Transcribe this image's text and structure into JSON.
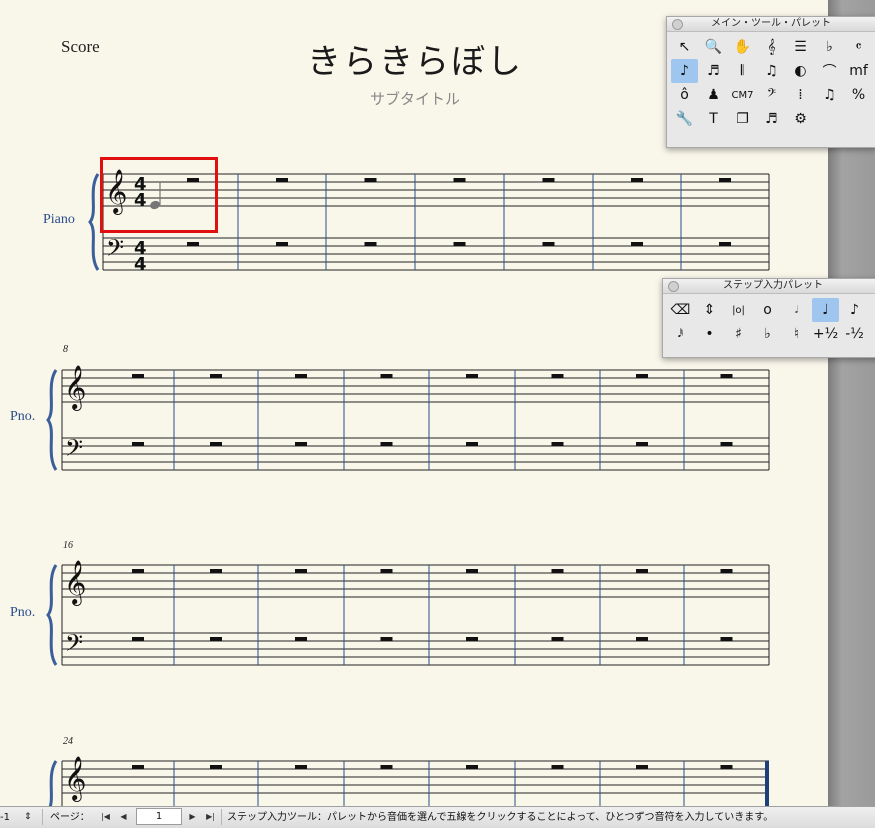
{
  "score": {
    "label": "Score",
    "title": "きらきらぼし",
    "subtitle": "サブタイトル"
  },
  "systems": [
    {
      "instrument": "Piano",
      "measure_number": ""
    },
    {
      "instrument": "Pno.",
      "measure_number": "8"
    },
    {
      "instrument": "Pno.",
      "measure_number": "16"
    },
    {
      "instrument": "",
      "measure_number": "24"
    }
  ],
  "time_signature": {
    "top": "4",
    "bottom": "4"
  },
  "main_palette": {
    "title": "メイン・ツール・パレット",
    "tools": [
      {
        "name": "select-arrow-icon",
        "glyph": "↖"
      },
      {
        "name": "zoom-icon",
        "glyph": "🔍"
      },
      {
        "name": "hand-icon",
        "glyph": "✋"
      },
      {
        "name": "clef-tool-icon",
        "glyph": "𝄞"
      },
      {
        "name": "staff-tool-icon",
        "glyph": "☰"
      },
      {
        "name": "key-signature-icon",
        "glyph": "♭"
      },
      {
        "name": "time-signature-icon",
        "glyph": "𝄴"
      },
      {
        "name": "simple-entry-icon",
        "glyph": "♪"
      },
      {
        "name": "speedy-entry-icon",
        "glyph": "♬"
      },
      {
        "name": "hyperscribe-icon",
        "glyph": "𝄃"
      },
      {
        "name": "tuplet-icon",
        "glyph": "♫"
      },
      {
        "name": "smart-shape-icon",
        "glyph": "◐"
      },
      {
        "name": "articulation-icon",
        "glyph": "⌒"
      },
      {
        "name": "expression-icon",
        "glyph": "mf"
      },
      {
        "name": "repeat-icon",
        "glyph": "ô"
      },
      {
        "name": "mirror-icon",
        "glyph": "♟"
      },
      {
        "name": "chord-icon",
        "glyph": "CM7"
      },
      {
        "name": "measure-tool-icon",
        "glyph": "𝄢"
      },
      {
        "name": "lyrics-icon",
        "glyph": "⁞"
      },
      {
        "name": "resize-icon",
        "glyph": "♫"
      },
      {
        "name": "percent-icon",
        "glyph": "%"
      },
      {
        "name": "wrench-icon",
        "glyph": "🔧"
      },
      {
        "name": "text-tool-icon",
        "glyph": "T"
      },
      {
        "name": "page-layout-icon",
        "glyph": "❐"
      },
      {
        "name": "note-mover-icon",
        "glyph": "♬"
      },
      {
        "name": "special-tools-icon",
        "glyph": "⚙"
      }
    ],
    "active_index": 7
  },
  "step_palette": {
    "title": "ステップ入力パレット",
    "row1": [
      {
        "name": "eraser-icon",
        "glyph": "⌫"
      },
      {
        "name": "stem-direction-icon",
        "glyph": "⇕"
      },
      {
        "name": "double-whole-note-icon",
        "glyph": "|o|"
      },
      {
        "name": "whole-note-icon",
        "glyph": "o"
      },
      {
        "name": "half-note-icon",
        "glyph": "𝅗𝅥"
      },
      {
        "name": "quarter-note-icon",
        "glyph": "♩"
      },
      {
        "name": "eighth-note-icon",
        "glyph": "♪"
      }
    ],
    "row2": [
      {
        "name": "sixty-fourth-note-icon",
        "glyph": "𝅘𝅥𝅱"
      },
      {
        "name": "dot-icon",
        "glyph": "•"
      },
      {
        "name": "sharp-icon",
        "glyph": "♯"
      },
      {
        "name": "flat-icon",
        "glyph": "♭"
      },
      {
        "name": "natural-icon",
        "glyph": "♮"
      },
      {
        "name": "half-step-up-icon",
        "glyph": "+½"
      },
      {
        "name": "half-step-down-icon",
        "glyph": "-½"
      }
    ],
    "active_index": 5
  },
  "statusbar": {
    "zoom": "-1",
    "page_label": "ページ：",
    "page_number": "1",
    "message": "ステップ入力ツール：パレットから音価を選んで五線をクリックすることによって、ひとつずつ音符を入力していきます。"
  }
}
